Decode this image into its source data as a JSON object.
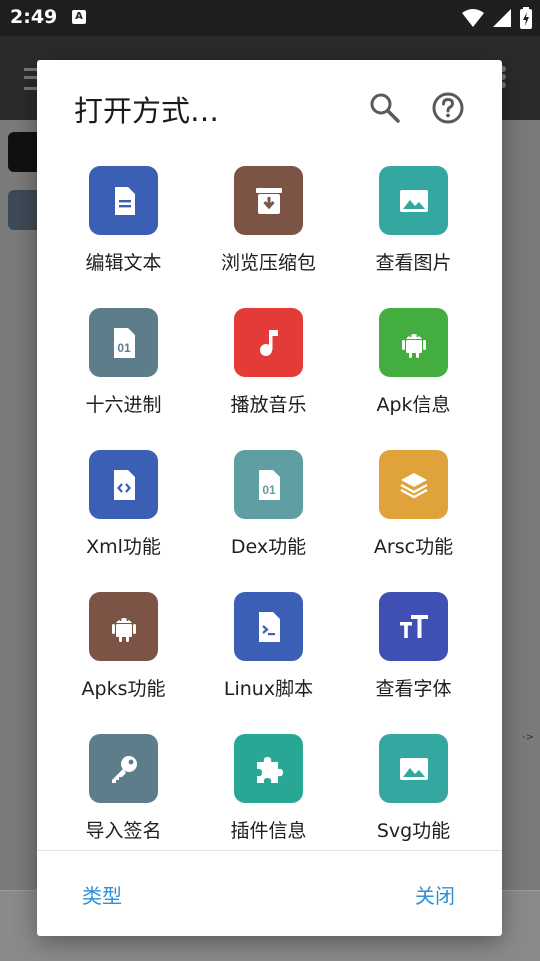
{
  "status_bar": {
    "time": "2:49",
    "notification_badge": "A",
    "icons": [
      "wifi-icon",
      "cell-signal-icon",
      "battery-charging-icon"
    ]
  },
  "dialog": {
    "title": "打开方式…",
    "items": [
      {
        "label": "编辑文本",
        "icon": "document-icon",
        "color": "#3a5fb5"
      },
      {
        "label": "浏览压缩包",
        "icon": "archive-icon",
        "color": "#7b5446"
      },
      {
        "label": "查看图片",
        "icon": "image-icon",
        "color": "#33a7a0"
      },
      {
        "label": "十六进制",
        "icon": "binary-file-icon",
        "color": "#5e7d8a"
      },
      {
        "label": "播放音乐",
        "icon": "music-note-icon",
        "color": "#e33b37"
      },
      {
        "label": "Apk信息",
        "icon": "android-icon",
        "color": "#43ad3f"
      },
      {
        "label": "Xml功能",
        "icon": "code-file-icon",
        "color": "#3a5fb5"
      },
      {
        "label": "Dex功能",
        "icon": "binary-file-icon",
        "color": "#5f9ea3"
      },
      {
        "label": "Arsc功能",
        "icon": "layers-icon",
        "color": "#e0a33b"
      },
      {
        "label": "Apks功能",
        "icon": "android-icon",
        "color": "#7b5446"
      },
      {
        "label": "Linux脚本",
        "icon": "terminal-file-icon",
        "color": "#3a5fb5"
      },
      {
        "label": "查看字体",
        "icon": "font-size-icon",
        "color": "#3f4fb3"
      },
      {
        "label": "导入签名",
        "icon": "key-icon",
        "color": "#5e7d8a"
      },
      {
        "label": "插件信息",
        "icon": "puzzle-icon",
        "color": "#2aa694"
      },
      {
        "label": "Svg功能",
        "icon": "image-icon",
        "color": "#33a7a0"
      }
    ],
    "buttons": {
      "type": "类型",
      "close": "关闭"
    }
  },
  "background": {
    "arrow_text": "->"
  },
  "colors": {
    "accent": "#2f8fd8",
    "dialog_bg": "#ffffff"
  }
}
